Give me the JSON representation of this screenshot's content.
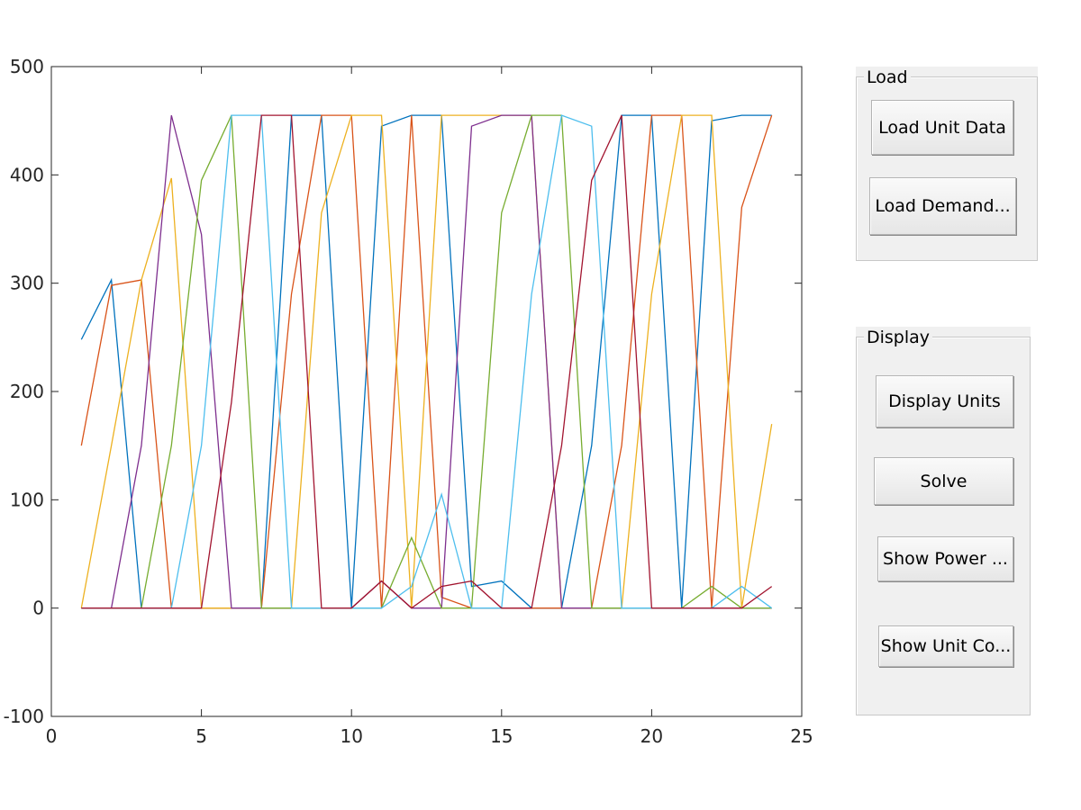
{
  "panels": {
    "load": {
      "title": "Load",
      "load_unit_data": "Load Unit Data",
      "load_demand": "Load Demand..."
    },
    "display": {
      "title": "Display",
      "display_units": "Display Units",
      "solve": "Solve",
      "show_power": "Show Power ...",
      "show_unit_co": "Show Unit Co..."
    }
  },
  "chart_data": {
    "type": "line",
    "xlim": [
      0,
      25
    ],
    "ylim": [
      -100,
      500
    ],
    "x_ticks": [
      0,
      5,
      10,
      15,
      20,
      25
    ],
    "y_ticks": [
      -100,
      0,
      100,
      200,
      300,
      400,
      500
    ],
    "grid": false,
    "x": [
      1,
      2,
      3,
      4,
      5,
      6,
      7,
      8,
      9,
      10,
      11,
      12,
      13,
      14,
      15,
      16,
      17,
      18,
      19,
      20,
      21,
      22,
      23,
      24
    ],
    "series": [
      {
        "color": "#0072BD",
        "values": [
          248,
          303,
          0,
          0,
          0,
          0,
          0,
          455,
          455,
          0,
          445,
          455,
          455,
          20,
          25,
          0,
          0,
          150,
          455,
          455,
          0,
          450,
          455,
          455
        ]
      },
      {
        "color": "#D95319",
        "values": [
          150,
          298,
          303,
          0,
          0,
          0,
          0,
          290,
          455,
          455,
          0,
          455,
          10,
          0,
          0,
          0,
          0,
          0,
          150,
          455,
          455,
          0,
          370,
          455
        ]
      },
      {
        "color": "#EDB120",
        "values": [
          0,
          150,
          303,
          397,
          0,
          0,
          0,
          0,
          365,
          455,
          455,
          0,
          455,
          455,
          455,
          455,
          0,
          0,
          0,
          290,
          455,
          455,
          0,
          170
        ]
      },
      {
        "color": "#7E2F8E",
        "values": [
          0,
          0,
          150,
          455,
          345,
          0,
          0,
          0,
          0,
          0,
          25,
          0,
          0,
          445,
          455,
          455,
          0,
          0,
          0,
          0,
          0,
          0,
          0,
          0
        ]
      },
      {
        "color": "#77AC30",
        "values": [
          0,
          0,
          0,
          150,
          395,
          455,
          0,
          0,
          0,
          0,
          0,
          65,
          0,
          0,
          365,
          455,
          455,
          0,
          0,
          0,
          0,
          20,
          0,
          0
        ]
      },
      {
        "color": "#4DBEEE",
        "values": [
          0,
          0,
          0,
          0,
          150,
          455,
          455,
          0,
          0,
          0,
          0,
          20,
          105,
          0,
          0,
          290,
          455,
          445,
          0,
          0,
          0,
          0,
          20,
          0
        ]
      },
      {
        "color": "#A2142F",
        "values": [
          0,
          0,
          0,
          0,
          0,
          190,
          455,
          455,
          0,
          0,
          25,
          0,
          20,
          25,
          0,
          0,
          150,
          395,
          455,
          0,
          0,
          0,
          0,
          20
        ]
      }
    ]
  }
}
